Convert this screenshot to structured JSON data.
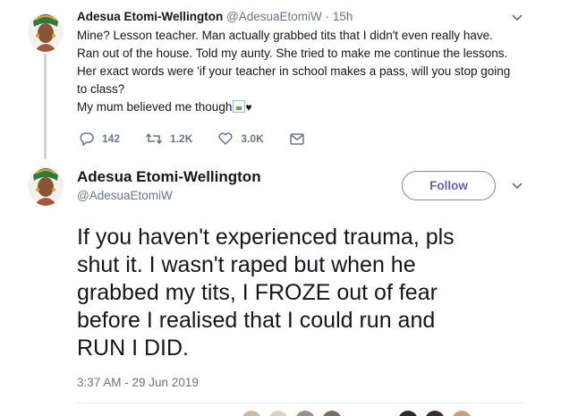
{
  "reply_tweet": {
    "author_name": "Adesua Etomi-Wellington",
    "author_handle": "@AdesuaEtomiW",
    "separator": "·",
    "time_ago": "15h",
    "lines": [
      "Mine? Lesson teacher. Man actually grabbed tits that I didn't even really have.",
      "Ran out of the house. Told my aunty. She tried to make me continue the lessons.",
      "Her exact words were 'if your teacher in school makes a pass, will you stop going",
      "to class?",
      "My mum believed me though"
    ],
    "emoji_suffix": "♥",
    "actions": {
      "replies": "142",
      "retweets": "1.2K",
      "likes": "3.0K"
    }
  },
  "main_tweet": {
    "author_name": "Adesua Etomi-Wellington",
    "author_handle": "@AdesuaEtomiW",
    "follow_label": "Follow",
    "lines": [
      "If you haven't experienced trauma, pls",
      "shut it. I wasn't raped but when he",
      "grabbed my tits, I FROZE out of fear",
      "before I realised that I could run and",
      "RUN I DID."
    ],
    "timestamp": "3:37 AM - 29 Jun 2019"
  },
  "colors": {
    "accent": "#6f5bb9",
    "muted": "#657786",
    "text": "#14171a",
    "thread_line": "#ccd6dd"
  },
  "icons": [
    "chevron-down-icon",
    "reply-icon",
    "retweet-icon",
    "like-icon",
    "message-icon"
  ]
}
